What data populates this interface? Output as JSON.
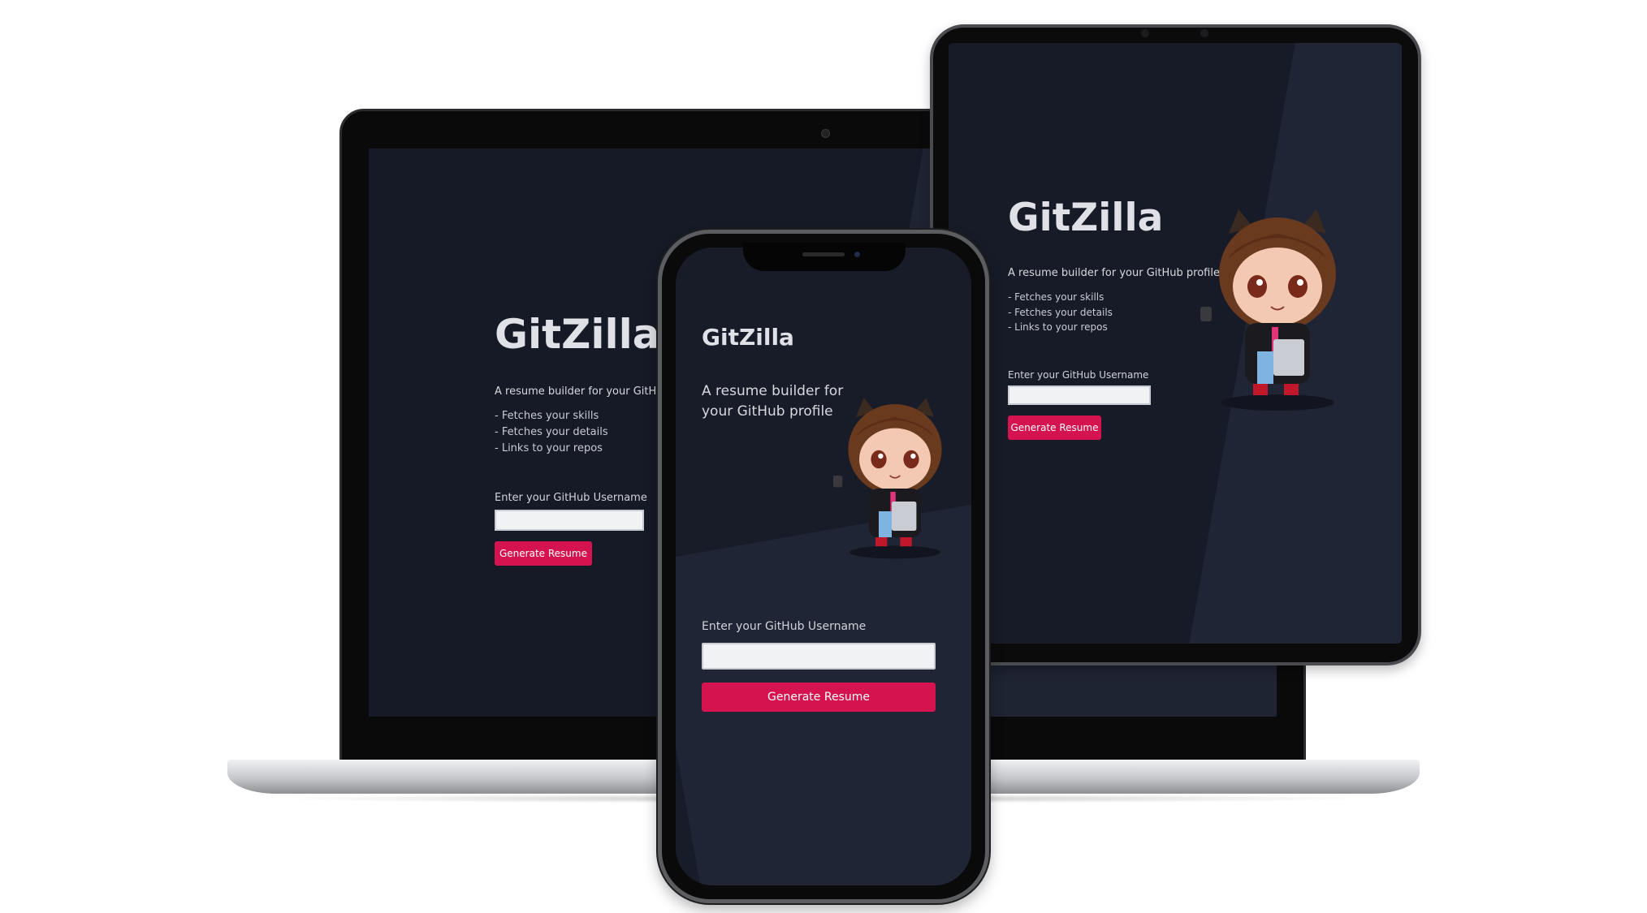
{
  "app": {
    "brand": "GitZilla",
    "tagline_full": "A resume builder for your GitHub profile.",
    "tagline_laptop": "A resume builder for your GitHub p",
    "tagline_phone": "A resume builder for your GitHub profile",
    "features": [
      "- Fetches your skills",
      "- Fetches your details",
      "- Links to your repos"
    ],
    "username_label": "Enter your GitHub Username",
    "username_value": "",
    "generate_button": "Generate Resume"
  },
  "icons": {
    "mascot": "octocat-mascot-icon",
    "camera": "camera-icon"
  },
  "colors": {
    "background": "#1b1f2c",
    "accent": "#d4134f",
    "text": "#dfe1e6"
  }
}
